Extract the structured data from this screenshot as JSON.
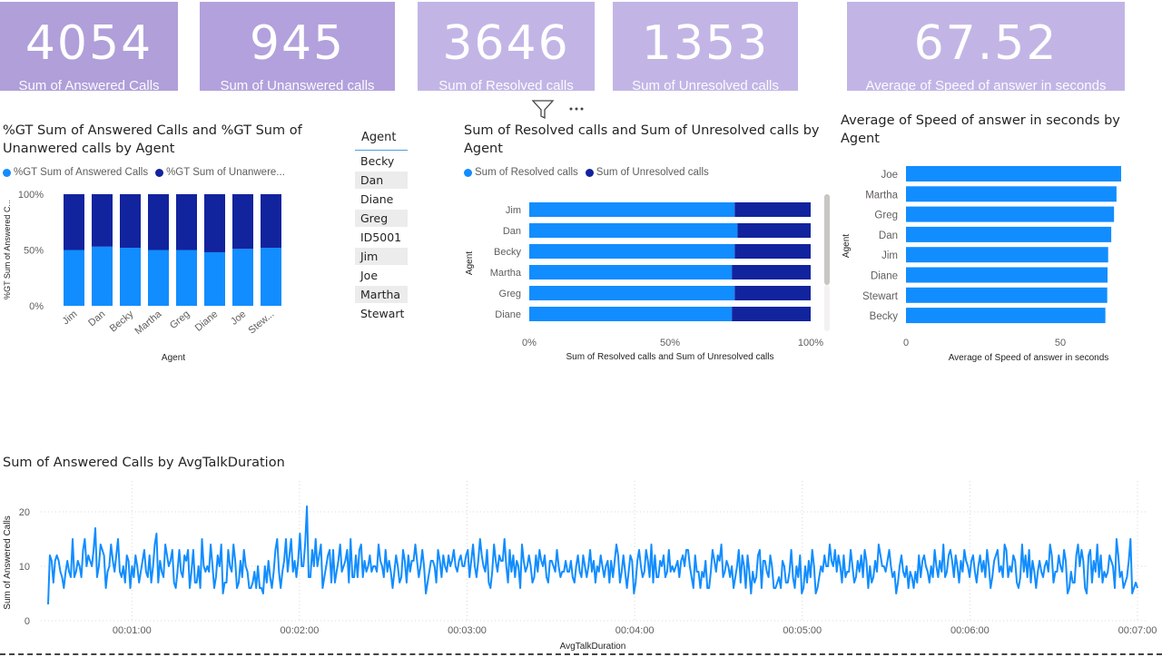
{
  "kpis": [
    {
      "value": "4054",
      "label": "Sum of Answered Calls"
    },
    {
      "value": "945",
      "label": "Sum of Unanswered calls"
    },
    {
      "value": "3646",
      "label": "Sum of Resolved calls"
    },
    {
      "value": "1353",
      "label": "Sum of Unresolved calls"
    },
    {
      "value": "67.52",
      "label": "Average of Speed of answer in seconds"
    }
  ],
  "colors": {
    "light": "#118dff",
    "dark": "#12239e",
    "kpi1": "#b09fd9",
    "kpi2": "#c2b5e6"
  },
  "chart1": {
    "title": "%GT Sum of Answered Calls and %GT Sum of Unanwered calls by Agent",
    "legend": [
      "%GT Sum of Answered Calls",
      "%GT Sum of Unanwere..."
    ]
  },
  "slicer": {
    "header": "Agent",
    "items": [
      "Becky",
      "Dan",
      "Diane",
      "Greg",
      "ID5001",
      "Jim",
      "Joe",
      "Martha",
      "Stewart"
    ]
  },
  "chart2": {
    "title": "Sum of Resolved calls and Sum of Unresolved calls by Agent",
    "legend": [
      "Sum of Resolved calls",
      "Sum of Unresolved calls"
    ]
  },
  "chart3": {
    "title": "Average of Speed of answer in seconds by Agent"
  },
  "chart4": {
    "title": "Sum of Answered Calls by AvgTalkDuration"
  },
  "visual_icons": {
    "filter": "filter-icon",
    "more": "more-options-icon"
  },
  "chart_data": [
    {
      "type": "bar",
      "stacked": "100%",
      "title": "%GT Sum of Answered Calls and %GT Sum of Unanwered calls by Agent",
      "xlabel": "Agent",
      "ylabel": "%GT Sum of Answered C...",
      "categories": [
        "Jim",
        "Dan",
        "Becky",
        "Martha",
        "Greg",
        "Diane",
        "Joe",
        "Stew..."
      ],
      "yticks": [
        "0%",
        "50%",
        "100%"
      ],
      "series": [
        {
          "name": "%GT Sum of Answered Calls",
          "values": [
            50,
            53,
            52,
            50,
            50,
            48,
            51,
            52
          ]
        },
        {
          "name": "%GT Sum of Unanwere...",
          "values": [
            50,
            47,
            48,
            50,
            50,
            52,
            49,
            48
          ]
        }
      ]
    },
    {
      "type": "bar",
      "orientation": "horizontal",
      "stacked": "100%",
      "title": "Sum of Resolved calls and Sum of Unresolved calls by Agent",
      "xlabel": "Sum of Resolved calls and Sum of Unresolved calls",
      "ylabel": "Agent",
      "categories": [
        "Jim",
        "Dan",
        "Becky",
        "Martha",
        "Greg",
        "Diane"
      ],
      "xticks": [
        "0%",
        "50%",
        "100%"
      ],
      "series": [
        {
          "name": "Sum of Resolved calls",
          "values": [
            73,
            74,
            73,
            72,
            73,
            72
          ]
        },
        {
          "name": "Sum of Unresolved calls",
          "values": [
            27,
            26,
            27,
            28,
            27,
            28
          ]
        }
      ]
    },
    {
      "type": "bar",
      "orientation": "horizontal",
      "title": "Average of Speed of answer in seconds by Agent",
      "xlabel": "Average of Speed of answer in seconds",
      "ylabel": "Agent",
      "categories": [
        "Joe",
        "Martha",
        "Greg",
        "Dan",
        "Jim",
        "Diane",
        "Stewart",
        "Becky"
      ],
      "values": [
        69.7,
        68.2,
        67.4,
        66.5,
        65.5,
        65.3,
        65.2,
        64.6
      ],
      "xlim": [
        0,
        72
      ],
      "xticks": [
        "0",
        "50"
      ]
    },
    {
      "type": "line",
      "title": "Sum of Answered Calls by AvgTalkDuration",
      "xlabel": "AvgTalkDuration",
      "ylabel": "Sum of Answered Calls",
      "ylim": [
        0,
        25
      ],
      "yticks": [
        "0",
        "10",
        "20"
      ],
      "xticks": [
        "00:01:00",
        "00:02:00",
        "00:03:00",
        "00:04:00",
        "00:05:00",
        "00:06:00",
        "00:07:00"
      ],
      "xrange_seconds": [
        30,
        420
      ],
      "y": [
        3,
        12,
        11,
        7,
        11,
        12,
        11,
        9,
        8,
        6,
        9,
        11,
        9,
        8,
        15,
        8,
        9,
        11,
        10,
        8,
        13,
        15,
        10,
        12,
        11,
        10,
        13,
        17,
        8,
        10,
        14,
        13,
        12,
        6,
        9,
        10,
        14,
        11,
        9,
        12,
        15,
        9,
        8,
        10,
        7,
        12,
        11,
        6,
        10,
        8,
        12,
        10,
        7,
        9,
        11,
        13,
        9,
        8,
        12,
        7,
        10,
        14,
        16,
        7,
        11,
        9,
        8,
        14,
        12,
        10,
        11,
        13,
        7,
        6,
        9,
        13,
        9,
        8,
        12,
        11,
        13,
        6,
        9,
        13,
        7,
        7,
        10,
        6,
        15,
        10,
        9,
        10,
        9,
        14,
        10,
        6,
        8,
        12,
        10,
        14,
        5,
        7,
        7,
        13,
        10,
        9,
        14,
        11,
        6,
        7,
        11,
        8,
        13,
        10,
        9,
        6,
        6,
        7,
        9,
        6,
        10,
        6,
        6,
        5,
        10,
        7,
        11,
        8,
        6,
        9,
        13,
        15,
        9,
        6,
        9,
        11,
        15,
        9,
        12,
        15,
        9,
        11,
        8,
        11,
        16,
        10,
        10,
        14,
        21,
        8,
        8,
        13,
        10,
        15,
        10,
        12,
        14,
        6,
        8,
        10,
        12,
        13,
        7,
        13,
        7,
        9,
        11,
        14,
        9,
        10,
        11,
        13,
        7,
        15,
        8,
        8,
        12,
        8,
        13,
        14,
        8,
        11,
        9,
        10,
        12,
        9,
        10,
        10,
        9,
        14,
        11,
        10,
        8,
        13,
        9,
        11,
        9,
        6,
        9,
        12,
        10,
        7,
        8,
        13,
        11,
        7,
        12,
        9,
        11,
        11,
        14,
        11,
        8,
        10,
        13,
        10,
        5,
        7,
        9,
        11,
        11,
        10,
        7,
        13,
        11,
        8,
        12,
        10,
        9,
        12,
        10,
        11,
        13,
        10,
        9,
        11,
        12,
        10,
        10,
        12,
        13,
        8,
        11,
        14,
        10,
        8,
        11,
        15,
        12,
        10,
        9,
        13,
        7,
        6,
        9,
        14,
        11,
        9,
        12,
        11,
        11,
        15,
        10,
        7,
        13,
        9,
        12,
        8,
        11,
        10,
        6,
        14,
        11,
        9,
        10,
        12,
        10,
        7,
        8,
        12,
        9,
        13,
        11,
        10,
        12,
        8,
        7,
        11,
        11,
        10,
        9,
        13,
        10,
        8,
        9,
        9,
        11,
        9,
        9,
        11,
        8,
        7,
        10,
        12,
        9,
        8,
        12,
        10,
        8,
        10,
        13,
        9,
        11,
        7,
        10,
        9,
        12,
        10,
        8,
        10,
        11,
        7,
        11,
        8,
        11,
        14,
        12,
        7,
        9,
        12,
        9,
        6,
        9,
        12,
        11,
        5,
        7,
        11,
        13,
        10,
        8,
        9,
        13,
        11,
        8,
        14,
        7,
        12,
        8,
        8,
        11,
        10,
        12,
        8,
        9,
        13,
        9,
        10,
        9,
        10,
        11,
        8,
        11,
        12,
        10,
        13,
        13,
        10,
        8,
        6,
        12,
        9,
        9,
        6,
        9,
        8,
        11,
        6,
        6,
        9,
        13,
        11,
        9,
        12,
        11,
        14,
        8,
        9,
        11,
        10,
        8,
        10,
        6,
        8,
        10,
        13,
        7,
        12,
        10,
        6,
        12,
        9,
        5,
        9,
        7,
        8,
        12,
        13,
        6,
        11,
        11,
        9,
        8,
        12,
        10,
        6,
        6,
        7,
        8,
        6,
        11,
        10,
        7,
        7,
        9,
        13,
        8,
        6,
        10,
        8,
        12,
        5,
        6,
        10,
        7,
        11,
        8,
        13,
        10,
        5,
        6,
        8,
        10,
        9,
        12,
        10,
        10,
        14,
        11,
        10,
        13,
        9,
        12,
        10,
        7,
        12,
        8,
        9,
        9,
        13,
        10,
        7,
        8,
        11,
        9,
        12,
        8,
        13,
        11,
        6,
        10,
        7,
        8,
        11,
        9,
        14,
        12,
        10,
        10,
        9,
        11,
        13,
        10,
        8,
        9,
        5,
        7,
        10,
        12,
        9,
        8,
        10,
        6,
        9,
        8,
        6,
        9,
        7,
        12,
        8,
        11,
        12,
        10,
        9,
        7,
        10,
        8,
        13,
        10,
        8,
        11,
        9,
        14,
        8,
        9,
        12,
        13,
        11,
        8,
        12,
        10,
        7,
        11,
        9,
        13,
        11,
        10,
        8,
        11,
        12,
        9,
        7,
        10,
        12,
        9,
        11,
        8,
        13,
        10,
        6,
        8,
        11,
        12,
        13,
        9,
        10,
        8,
        14,
        13,
        8,
        10,
        9,
        12,
        11,
        7,
        6,
        8,
        14,
        9,
        12,
        8,
        13,
        7,
        11,
        9,
        6,
        9,
        11,
        9,
        8,
        10,
        11,
        9,
        14,
        12,
        7,
        9,
        9,
        12,
        10,
        9,
        13,
        11,
        5,
        6,
        9,
        7,
        7,
        12,
        14,
        10,
        13,
        11,
        6,
        5,
        12,
        13,
        7,
        11,
        9,
        14,
        8,
        12,
        7,
        9,
        8,
        9,
        12,
        11,
        10,
        6,
        15,
        12,
        8,
        9,
        6,
        7,
        8,
        11,
        15,
        5,
        6,
        7,
        6
      ]
    }
  ]
}
